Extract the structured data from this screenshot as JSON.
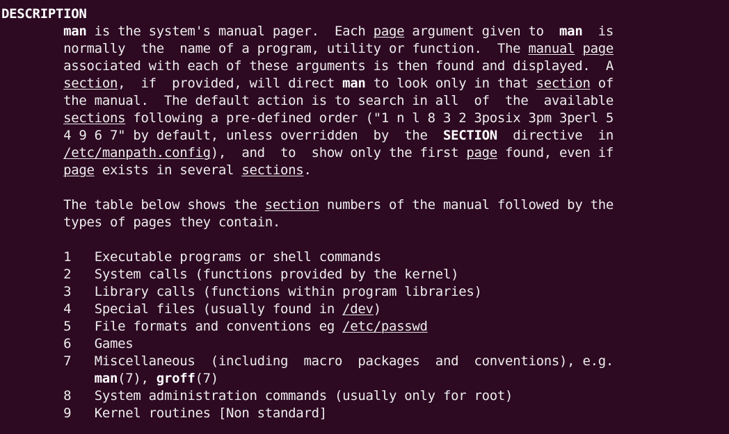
{
  "terminal": {
    "background_color": "#2d0922",
    "foreground_color": "#ededec",
    "bold_color": "#ffffff",
    "font_size_px": 19,
    "line_height_px": 25,
    "columns": 80
  },
  "manpage": {
    "section_heading": "DESCRIPTION",
    "paragraph1": {
      "line1": {
        "pre": "",
        "bold1": "man",
        "mid1": " is the system's manual pager.  Each ",
        "link1": "page",
        "mid2": " argument given to  ",
        "bold2": "man",
        "post": "  is"
      },
      "line2": {
        "pre": "normally  the  name of a program, utility or function.  The ",
        "link1": "manual",
        "mid1": " ",
        "link2": "page"
      },
      "line3": {
        "pre": "associated with each of these arguments is then found and displayed.  A"
      },
      "line4": {
        "link1": "section",
        "mid1": ",  if  provided, will direct ",
        "bold1": "man",
        "mid2": " to look only in that ",
        "link2": "section",
        "post": " of"
      },
      "line5": {
        "pre": "the manual.  The default action is to search in all  of  the  available"
      },
      "line6": {
        "link1": "sections",
        "post": " following a pre-defined order (\"1 n l 8 3 2 3posix 3pm 3perl 5"
      },
      "line7": {
        "pre": "4 9 6 7\" by default, unless overridden  by  the  ",
        "bold1": "SECTION",
        "post": "  directive  in"
      },
      "line8": {
        "link1": "/etc/manpath.config",
        "mid1": "),  and  to  show only the first ",
        "link2": "page",
        "post": " found, even if"
      },
      "line9": {
        "link1": "page",
        "mid1": " exists in several ",
        "link2": "sections",
        "post": "."
      }
    },
    "paragraph2": {
      "line1": {
        "pre": "The table below shows the ",
        "link1": "section",
        "post": " numbers of the manual followed by the"
      },
      "line2": {
        "pre": "types of pages they contain."
      }
    },
    "section_table": [
      {
        "number": "1",
        "pre": "Executable programs or shell commands",
        "link": "",
        "post": ""
      },
      {
        "number": "2",
        "pre": "System calls (functions provided by the kernel)",
        "link": "",
        "post": ""
      },
      {
        "number": "3",
        "pre": "Library calls (functions within program libraries)",
        "link": "",
        "post": ""
      },
      {
        "number": "4",
        "pre": "Special files (usually found in ",
        "link": "/dev",
        "post": ")"
      },
      {
        "number": "5",
        "pre": "File formats and conventions eg ",
        "link": "/etc/passwd",
        "post": ""
      },
      {
        "number": "6",
        "pre": "Games",
        "link": "",
        "post": ""
      },
      {
        "number": "7",
        "pre": "Miscellaneous  (including  macro  packages  and  conventions), e.g.",
        "link": "",
        "post": ""
      },
      {
        "number": "8",
        "pre": "System administration commands (usually only for root)",
        "link": "",
        "post": ""
      },
      {
        "number": "9",
        "pre": "Kernel routines [Non standard]",
        "link": "",
        "post": ""
      }
    ],
    "section7_continuation": {
      "indent": "            ",
      "bold1": "man",
      "mid1": "(7), ",
      "bold2": "groff",
      "post": "(7)"
    },
    "indent8": "        ",
    "indent12": "            ",
    "number_gap": "   "
  }
}
